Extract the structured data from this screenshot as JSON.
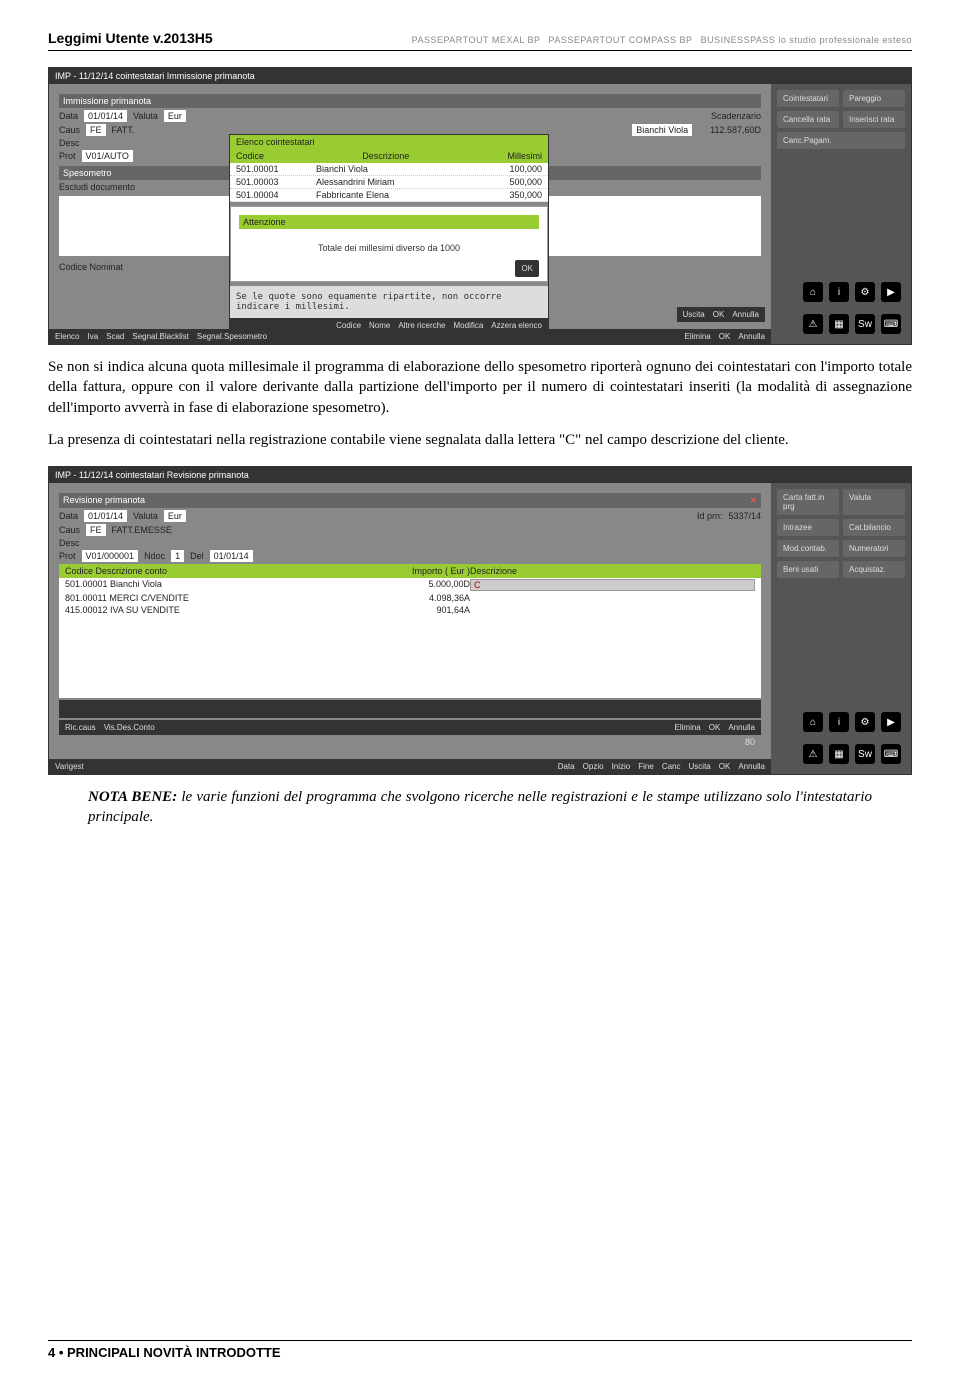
{
  "header": {
    "title": "Leggimi Utente v.2013H5",
    "brands": [
      "PASSEPARTOUT MEXAL BP",
      "PASSEPARTOUT COMPASS BP",
      "BUSINESSPASS lo studio professionale esteso"
    ]
  },
  "paragraph1": "Se non si indica alcuna quota millesimale il programma di elaborazione dello spesometro riporterà ognuno dei cointestatari con l'importo totale della fattura, oppure con il valore derivante dalla partizione dell'importo per il numero di cointestatari inseriti (la modalità di assegnazione dell'importo avverrà in fase di elaborazione spesometro).",
  "paragraph2": "La presenza di cointestatari nella registrazione contabile viene segnalata dalla lettera \"C\" nel campo descrizione del cliente.",
  "note_label": "NOTA BENE:",
  "note_text": " le varie funzioni del programma che svolgono ricerche nelle registrazioni e le stampe utilizzano solo l'intestatario principale.",
  "footer": "4 • PRINCIPALI NOVITÀ INTRODOTTE",
  "shot1": {
    "title": "IMP - 11/12/14 cointestatari   Immissione primanota",
    "panel_title": "Immissione primanota",
    "data_label": "Data",
    "data_val": "01/01/14",
    "valuta_label": "Valuta",
    "valuta_val": "Eur",
    "caus_label": "Caus",
    "caus_val": "FE",
    "caus_desc": "FATT.",
    "desc_label": "Desc",
    "prot_label": "Prot",
    "prot_val": "V01/AUTO",
    "scad_title": "Scadenzario",
    "scad_val": "Bianchi Viola",
    "amount": "112.587,60D",
    "spes_title": "Spesometro",
    "escludi": "Escludi documento",
    "elenco_title": "Elenco cointestatari",
    "list_headers": [
      "Codice",
      "Descrizione",
      "Millesimi"
    ],
    "list_rows": [
      [
        "501.00001",
        "Bianchi Viola",
        "100,000"
      ],
      [
        "501.00003",
        "Alessandrini Miriam",
        "500,000"
      ],
      [
        "501.00004",
        "Fabbricante Elena",
        "350,000"
      ]
    ],
    "warn_title": "Attenzione",
    "warn_text": "Totale dei millesimi diverso da 1000",
    "ok_btn": "OK",
    "hint": "Se le quote sono equamente ripartite, non occorre indicare i millesimi.",
    "modal_footer": [
      "Codice",
      "Nome",
      "Altre ricerche",
      "Modifica",
      "Azzera elenco"
    ],
    "side_buttons": [
      "Cointestatari",
      "Pareggio",
      "Cancella rata",
      "Inserisci rata",
      "Canc.Pagam."
    ],
    "codice_nominat": "Codice    Nominat",
    "bottom1": [
      "Uscita",
      "OK",
      "Annulla"
    ],
    "bottom2": [
      "Elimina",
      "OK",
      "Annulla"
    ],
    "bottom3": [
      "Elenco",
      "Iva",
      "Scad",
      "Segnal.Blacklist",
      "Segnal.Spesometro"
    ]
  },
  "shot2": {
    "title": "IMP - 11/12/14 cointestatari   Revisione primanota",
    "panel_title": "Revisione primanota",
    "data_label": "Data",
    "data_val": "01/01/14",
    "valuta_label": "Valuta",
    "valuta_val": "Eur",
    "caus_label": "Caus",
    "caus_val": "FE",
    "caus_desc": "FATT.EMESSE",
    "desc_label": "Desc",
    "prot_label": "Prot",
    "prot_val": "V01/000001",
    "ndoc_label": "Ndoc",
    "ndoc_val": "1",
    "del_label": "Del",
    "del_val": "01/01/14",
    "idprn_label": "Id prn:",
    "idprn_val": "5337/14",
    "table_headers": [
      "Codice Descrizione conto",
      "Importo   ( Eur )",
      "Descrizione"
    ],
    "table_rows": [
      [
        "501.00001 Bianchi Viola",
        "5.000,00D",
        ""
      ],
      [
        "801.00011 MERCI C/VENDITE",
        "4.098,36A",
        ""
      ],
      [
        "415.00012 IVA SU VENDITE",
        "901,64A",
        ""
      ]
    ],
    "c_badge": "C",
    "side_buttons": [
      "Carta fatt.in prg",
      "Valuta",
      "Intrazee",
      "Cat.bilancio",
      "Mod.contab.",
      "Numeratori",
      "Beni usati",
      "Acquistaz."
    ],
    "bottom_left": [
      "Ric.caus",
      "Vis.Des.Conto"
    ],
    "bottom_right": [
      "Elimina",
      "OK",
      "Annulla"
    ],
    "page80": "80",
    "footer_row": [
      "Varigest",
      "Data",
      "Opzio",
      "Inizio",
      "Fine",
      "Canc",
      "Uscita",
      "OK",
      "Annulla"
    ]
  }
}
